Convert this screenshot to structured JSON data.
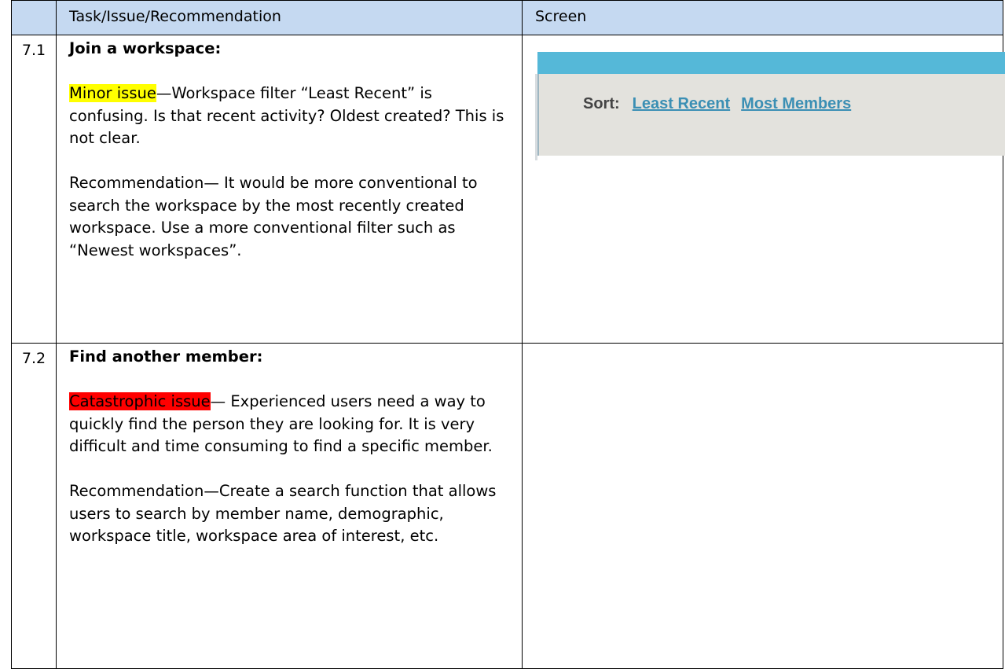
{
  "header": {
    "num": "",
    "task": "Task/Issue/Recommendation",
    "screen": "Screen"
  },
  "rows": [
    {
      "num": "7.1",
      "title": "Join a workspace:",
      "issue_label": "Minor issue",
      "issue_text": "—Workspace filter “Least Recent” is confusing. Is that recent activity? Oldest created? This is not clear.",
      "recommendation": "Recommendation— It would be more conventional to search the workspace by the most recently created workspace. Use a more conventional filter such as “Newest workspaces”.",
      "screen": {
        "sort_label": "Sort:",
        "links": [
          "Least Recent",
          "Most Members"
        ],
        "colors": {
          "bar": "#55b8d8",
          "panel": "#e3e2dd",
          "link": "#3b8fb4"
        }
      }
    },
    {
      "num": "7.2",
      "title": "Find another member:",
      "issue_label": "Catastrophic issue",
      "issue_text": "— Experienced users need a way to quickly find the person they are looking for. It is very difficult and time consuming to find a specific member.",
      "recommendation": "Recommendation—Create a search function that allows users to search by member name, demographic, workspace title, workspace area of interest, etc."
    }
  ],
  "highlight_colors": {
    "minor": "#ffff00",
    "catastrophic": "#ff0000",
    "header": "#c5d9f1"
  }
}
